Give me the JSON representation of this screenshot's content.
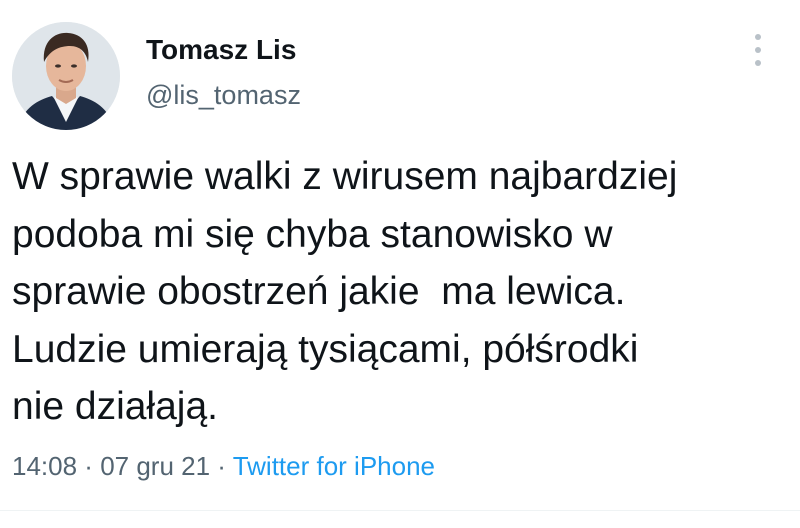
{
  "author": {
    "name": "Tomasz Lis",
    "handle": "@lis_tomasz",
    "avatar": "profile-photo"
  },
  "tweet": {
    "lines": [
      "W sprawie walki z wirusem najbardziej",
      "podoba mi się chyba stanowisko w",
      "sprawie obostrzeń jakie  ma lewica.",
      "Ludzie umierają tysiącami, półśrodki",
      "nie działają."
    ]
  },
  "meta": {
    "time": "14:08",
    "sep1": " · ",
    "date": "07 gru 21",
    "sep2": " · ",
    "source": "Twitter for iPhone"
  },
  "icons": {
    "more": "more-vertical-icon"
  },
  "colors": {
    "text": "#0f1419",
    "secondary": "#536471",
    "link": "#1d9bf0",
    "more_dots": "#b9c1c8"
  }
}
